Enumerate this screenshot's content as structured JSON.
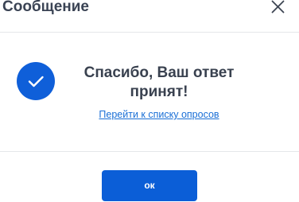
{
  "dialog": {
    "title": "Сообщение",
    "close_icon": "close-icon"
  },
  "content": {
    "status_icon": "checkmark-icon",
    "message": "Спасибо, Ваш ответ принят!",
    "link_text": "Перейти к списку опросов"
  },
  "footer": {
    "ok_label": "ок"
  },
  "colors": {
    "accent": "#0b5ed7",
    "link": "#1a6fd6",
    "title_text": "#3a4354"
  }
}
